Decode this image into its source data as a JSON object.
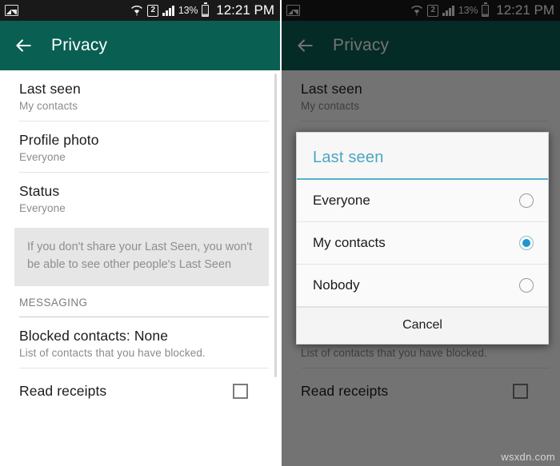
{
  "status_bar": {
    "left_icon": "gallery-icon",
    "wifi_icon": "wifi-icon",
    "sim_label": "2",
    "signal_icon": "signal-bars-icon",
    "battery_percent": "13%",
    "battery_icon": "battery-icon",
    "time": "12:21 PM"
  },
  "app_bar": {
    "back_icon": "back-arrow-icon",
    "title": "Privacy"
  },
  "settings": {
    "rows": [
      {
        "title": "Last seen",
        "subtitle": "My contacts"
      },
      {
        "title": "Profile photo",
        "subtitle": "Everyone"
      },
      {
        "title": "Status",
        "subtitle": "Everyone"
      }
    ],
    "info_text": "If you don't share your Last Seen, you won't be able to see other people's Last Seen",
    "section_header": "MESSAGING",
    "blocked": {
      "title": "Blocked contacts: None",
      "subtitle": "List of contacts that you have blocked."
    },
    "read_receipts": {
      "title": "Read receipts",
      "checked": false
    }
  },
  "dialog": {
    "title": "Last seen",
    "options": [
      {
        "label": "Everyone",
        "selected": false
      },
      {
        "label": "My contacts",
        "selected": true
      },
      {
        "label": "Nobody",
        "selected": false
      }
    ],
    "cancel_label": "Cancel"
  },
  "watermark": "wsxdn.com",
  "colors": {
    "appbar_teal": "#096052",
    "dialog_title_blue": "#4aa6c4",
    "radio_selected_blue": "#1e96d2",
    "status_bar_black": "#191919",
    "info_box_gray": "#e6e6e6"
  }
}
